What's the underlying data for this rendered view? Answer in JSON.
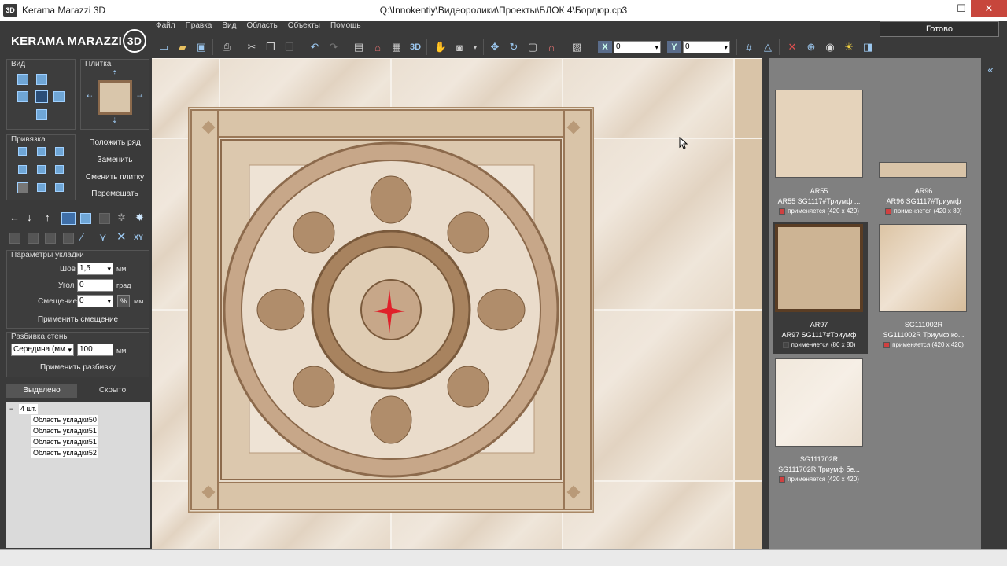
{
  "window": {
    "app_icon": "3D",
    "app_title": "Kerama Marazzi 3D",
    "document_title": "Q:\\Innokentiy\\Видеоролики\\Проекты\\БЛОК 4\\Бордюр.cp3",
    "min": "–",
    "max": "☐",
    "close": "✕"
  },
  "logo": {
    "text": "KERAMA MARAZZI",
    "badge": "3D"
  },
  "menu": [
    "Файл",
    "Правка",
    "Вид",
    "Область",
    "Объекты",
    "Помощь"
  ],
  "toolbar": {
    "x_value": "0",
    "y_value": "0",
    "x_label": "X",
    "y_label": "Y",
    "label_3d": "3D"
  },
  "done_button": "Готово",
  "left": {
    "view_label": "Вид",
    "tile_label": "Плитка",
    "snap_label": "Привязка",
    "lay_row": "Положить ряд",
    "replace": "Заменить",
    "change_tile": "Сменить плитку",
    "shuffle": "Перемешать",
    "layout_params": "Параметры укладки",
    "seam_label": "Шов",
    "seam_value": "1,5",
    "seam_unit": "мм",
    "angle_label": "Угол",
    "angle_value": "0",
    "angle_unit": "град",
    "offset_label": "Смещение",
    "offset_value": "0",
    "offset_pct": "%",
    "offset_unit": "мм",
    "apply_offset": "Применить смещение",
    "wall_split": "Разбивка стены",
    "split_mode": "Середина (мм",
    "split_value": "100",
    "split_unit": "мм",
    "apply_split": "Применить разбивку",
    "tab_selected": "Выделено",
    "tab_hidden": "Скрыто",
    "tree_expander": "−",
    "tree_root": "4 шт.",
    "tree_items": [
      "Область укладки50",
      "Область укладки51",
      "Область укладки51",
      "Область укладки52"
    ]
  },
  "tiles": [
    {
      "code": "AR55",
      "name": "AR55 SG1117#Триумф ...",
      "usage": "применяется (420 x 420)",
      "used": true
    },
    {
      "code": "AR96",
      "name": "AR96 SG1117#Триумф",
      "usage": "применяется (420 x 80)",
      "used": true
    },
    {
      "code": "AR97",
      "name": "AR97 SG1117#Триумф",
      "usage": "применяется (80 x 80)",
      "used": false
    },
    {
      "code": "SG111002R",
      "name": "SG111002R Триумф ко...",
      "usage": "применяется (420 x 420)",
      "used": true
    },
    {
      "code": "SG111702R",
      "name": "SG111702R Триумф бе...",
      "usage": "применяется (420 x 420)",
      "used": true
    }
  ],
  "colors": {
    "accent": "#6fa6d6",
    "used_marker": "#d04040",
    "cursor_mark": "#e0202a"
  }
}
